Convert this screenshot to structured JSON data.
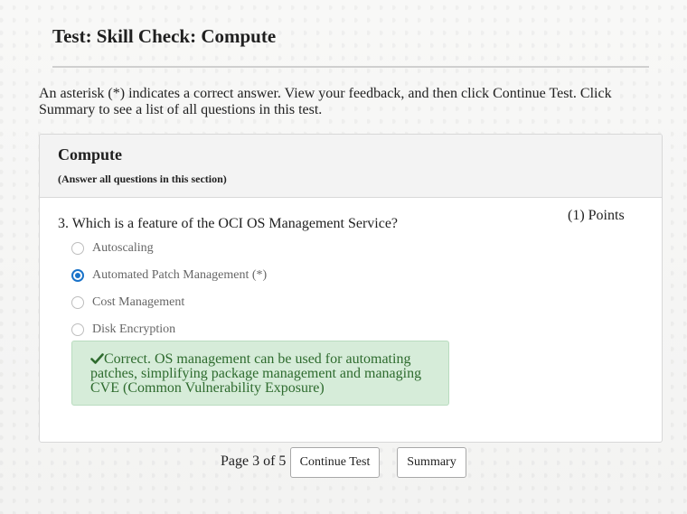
{
  "header": {
    "title": "Test: Skill Check: Compute"
  },
  "instructions": "An asterisk (*) indicates a correct answer. View your feedback, and then click Continue Test. Click Summary to see a list of all questions in this test.",
  "section": {
    "title": "Compute",
    "subtitle": "(Answer all questions in this section)"
  },
  "question": {
    "text": "3. Which is a feature of the OCI OS Management Service?",
    "points": "(1) Points",
    "options": [
      {
        "label": "Autoscaling",
        "selected": false
      },
      {
        "label": "Automated Patch Management (*)",
        "selected": true
      },
      {
        "label": "Cost Management",
        "selected": false
      },
      {
        "label": "Disk Encryption",
        "selected": false
      }
    ],
    "feedback": "Correct. OS management can be used for automating patches, simplifying package management and managing CVE (Common Vulnerability Exposure)",
    "feedback_icon": "checkmark-icon"
  },
  "footer": {
    "page_label": "Page 3 of 5",
    "continue_label": "Continue Test",
    "summary_label": "Summary"
  },
  "colors": {
    "accent": "#1a73c9",
    "feedback_bg": "#d6ecd9",
    "feedback_text": "#2e6b2e"
  }
}
